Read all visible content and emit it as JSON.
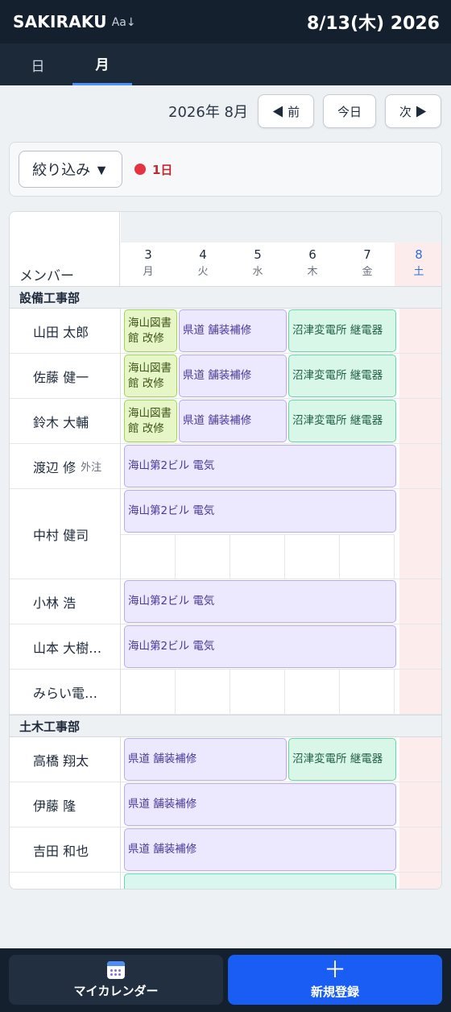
{
  "header": {
    "app_title": "SAKIRAKU",
    "font_toggle": "Aa↓",
    "date": "8/13(木) 2026"
  },
  "tabs": [
    {
      "label": "日",
      "active": false
    },
    {
      "label": "月",
      "active": true
    }
  ],
  "nav": {
    "month_label": "2026年 8月",
    "prev_label": "◀ 前",
    "today_label": "今日",
    "next_label": "次 ▶"
  },
  "filter": {
    "button_label": "絞り込み ▼",
    "badge_text": "1日"
  },
  "calendar": {
    "member_header": "メンバー",
    "days": [
      {
        "num": "3",
        "dow": "月",
        "sat": false
      },
      {
        "num": "4",
        "dow": "火",
        "sat": false
      },
      {
        "num": "5",
        "dow": "水",
        "sat": false
      },
      {
        "num": "6",
        "dow": "木",
        "sat": false
      },
      {
        "num": "7",
        "dow": "金",
        "sat": false
      },
      {
        "num": "8",
        "dow": "土",
        "sat": true
      }
    ],
    "departments": [
      {
        "name": "設備工事部",
        "members": [
          {
            "name": "山田 太郎",
            "sub": "",
            "tall": false,
            "events": [
              {
                "label": "海山図書館 改修",
                "color": "yellow",
                "start": 0,
                "span": 1
              },
              {
                "label": "県道 舗装補修",
                "color": "purple",
                "start": 1,
                "span": 2
              },
              {
                "label": "沼津変電所 継電器",
                "color": "green",
                "start": 3,
                "span": 2
              }
            ]
          },
          {
            "name": "佐藤 健一",
            "sub": "",
            "tall": false,
            "events": [
              {
                "label": "海山図書館 改修",
                "color": "yellow",
                "start": 0,
                "span": 1
              },
              {
                "label": "県道 舗装補修",
                "color": "purple",
                "start": 1,
                "span": 2
              },
              {
                "label": "沼津変電所 継電器",
                "color": "green",
                "start": 3,
                "span": 2
              }
            ]
          },
          {
            "name": "鈴木 大輔",
            "sub": "",
            "tall": false,
            "events": [
              {
                "label": "海山図書館 改修",
                "color": "yellow",
                "start": 0,
                "span": 1
              },
              {
                "label": "県道 舗装補修",
                "color": "purple",
                "start": 1,
                "span": 2
              },
              {
                "label": "沼津変電所 継電器",
                "color": "green",
                "start": 3,
                "span": 2
              }
            ]
          },
          {
            "name": "渡辺 修",
            "sub": "外注",
            "tall": false,
            "events": [
              {
                "label": "海山第2ビル 電気",
                "color": "purple",
                "start": 0,
                "span": 5
              }
            ]
          },
          {
            "name": "中村 健司",
            "sub": "",
            "tall": true,
            "events": [
              {
                "label": "海山第2ビル 電気",
                "color": "purple",
                "start": 0,
                "span": 5
              }
            ]
          },
          {
            "name": "小林 浩",
            "sub": "",
            "tall": false,
            "events": [
              {
                "label": "海山第2ビル 電気",
                "color": "purple",
                "start": 0,
                "span": 5
              }
            ]
          },
          {
            "name": "山本 大樹…",
            "sub": "",
            "tall": false,
            "events": [
              {
                "label": "海山第2ビル 電気",
                "color": "purple",
                "start": 0,
                "span": 5
              }
            ]
          },
          {
            "name": "みらい電…",
            "sub": "",
            "tall": false,
            "events": []
          }
        ]
      },
      {
        "name": "土木工事部",
        "members": [
          {
            "name": "高橋 翔太",
            "sub": "",
            "tall": false,
            "events": [
              {
                "label": "県道 舗装補修",
                "color": "purple",
                "start": 0,
                "span": 3
              },
              {
                "label": "沼津変電所 継電器",
                "color": "green",
                "start": 3,
                "span": 2
              }
            ]
          },
          {
            "name": "伊藤 隆",
            "sub": "",
            "tall": false,
            "events": [
              {
                "label": "県道 舗装補修",
                "color": "purple",
                "start": 0,
                "span": 5
              }
            ]
          },
          {
            "name": "吉田 和也",
            "sub": "",
            "tall": false,
            "events": [
              {
                "label": "県道 舗装補修",
                "color": "purple",
                "start": 0,
                "span": 5
              }
            ]
          }
        ]
      }
    ]
  },
  "bottom": {
    "my_calendar_label": "マイカレンダー",
    "new_label": "新規登録",
    "plus": "＋"
  }
}
